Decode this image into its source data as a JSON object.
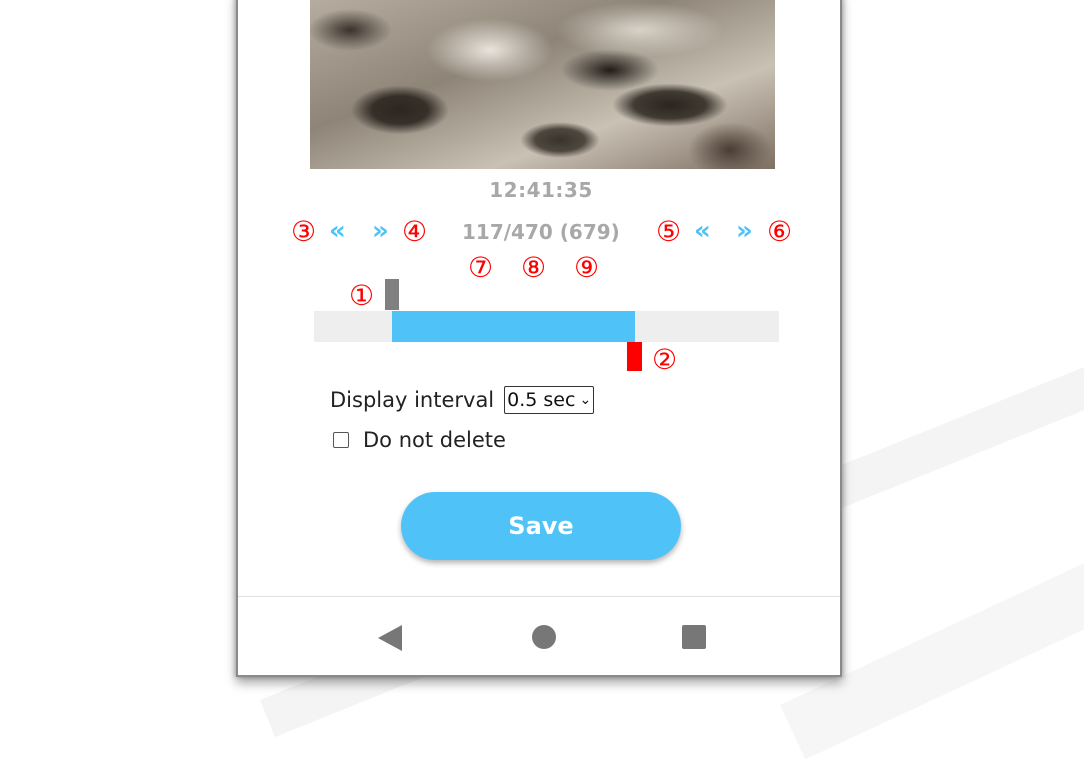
{
  "preview": {
    "timestamp": "12:41:35"
  },
  "frame_nav": {
    "rewind_start_label": "«",
    "forward_start_label": "»",
    "frame_info": "117/470 (679)",
    "rewind_end_label": "«",
    "forward_end_label": "»"
  },
  "annotations": {
    "m1": "①",
    "m2": "②",
    "m3": "③",
    "m4": "④",
    "m5": "⑤",
    "m6": "⑥",
    "m7": "⑦",
    "m8": "⑧",
    "m9": "⑨"
  },
  "range_slider": {
    "accent_color": "#4fc3f7",
    "start_handle_color": "#808080",
    "end_handle_color": "#ff0000"
  },
  "settings": {
    "interval_label": "Display interval",
    "interval_value": "0.5 sec",
    "do_not_delete_label": "Do not delete",
    "do_not_delete_checked": false
  },
  "actions": {
    "save_label": "Save"
  },
  "system_nav": {
    "back_icon": "triangle-back-icon",
    "home_icon": "circle-home-icon",
    "recent_icon": "square-recents-icon"
  }
}
